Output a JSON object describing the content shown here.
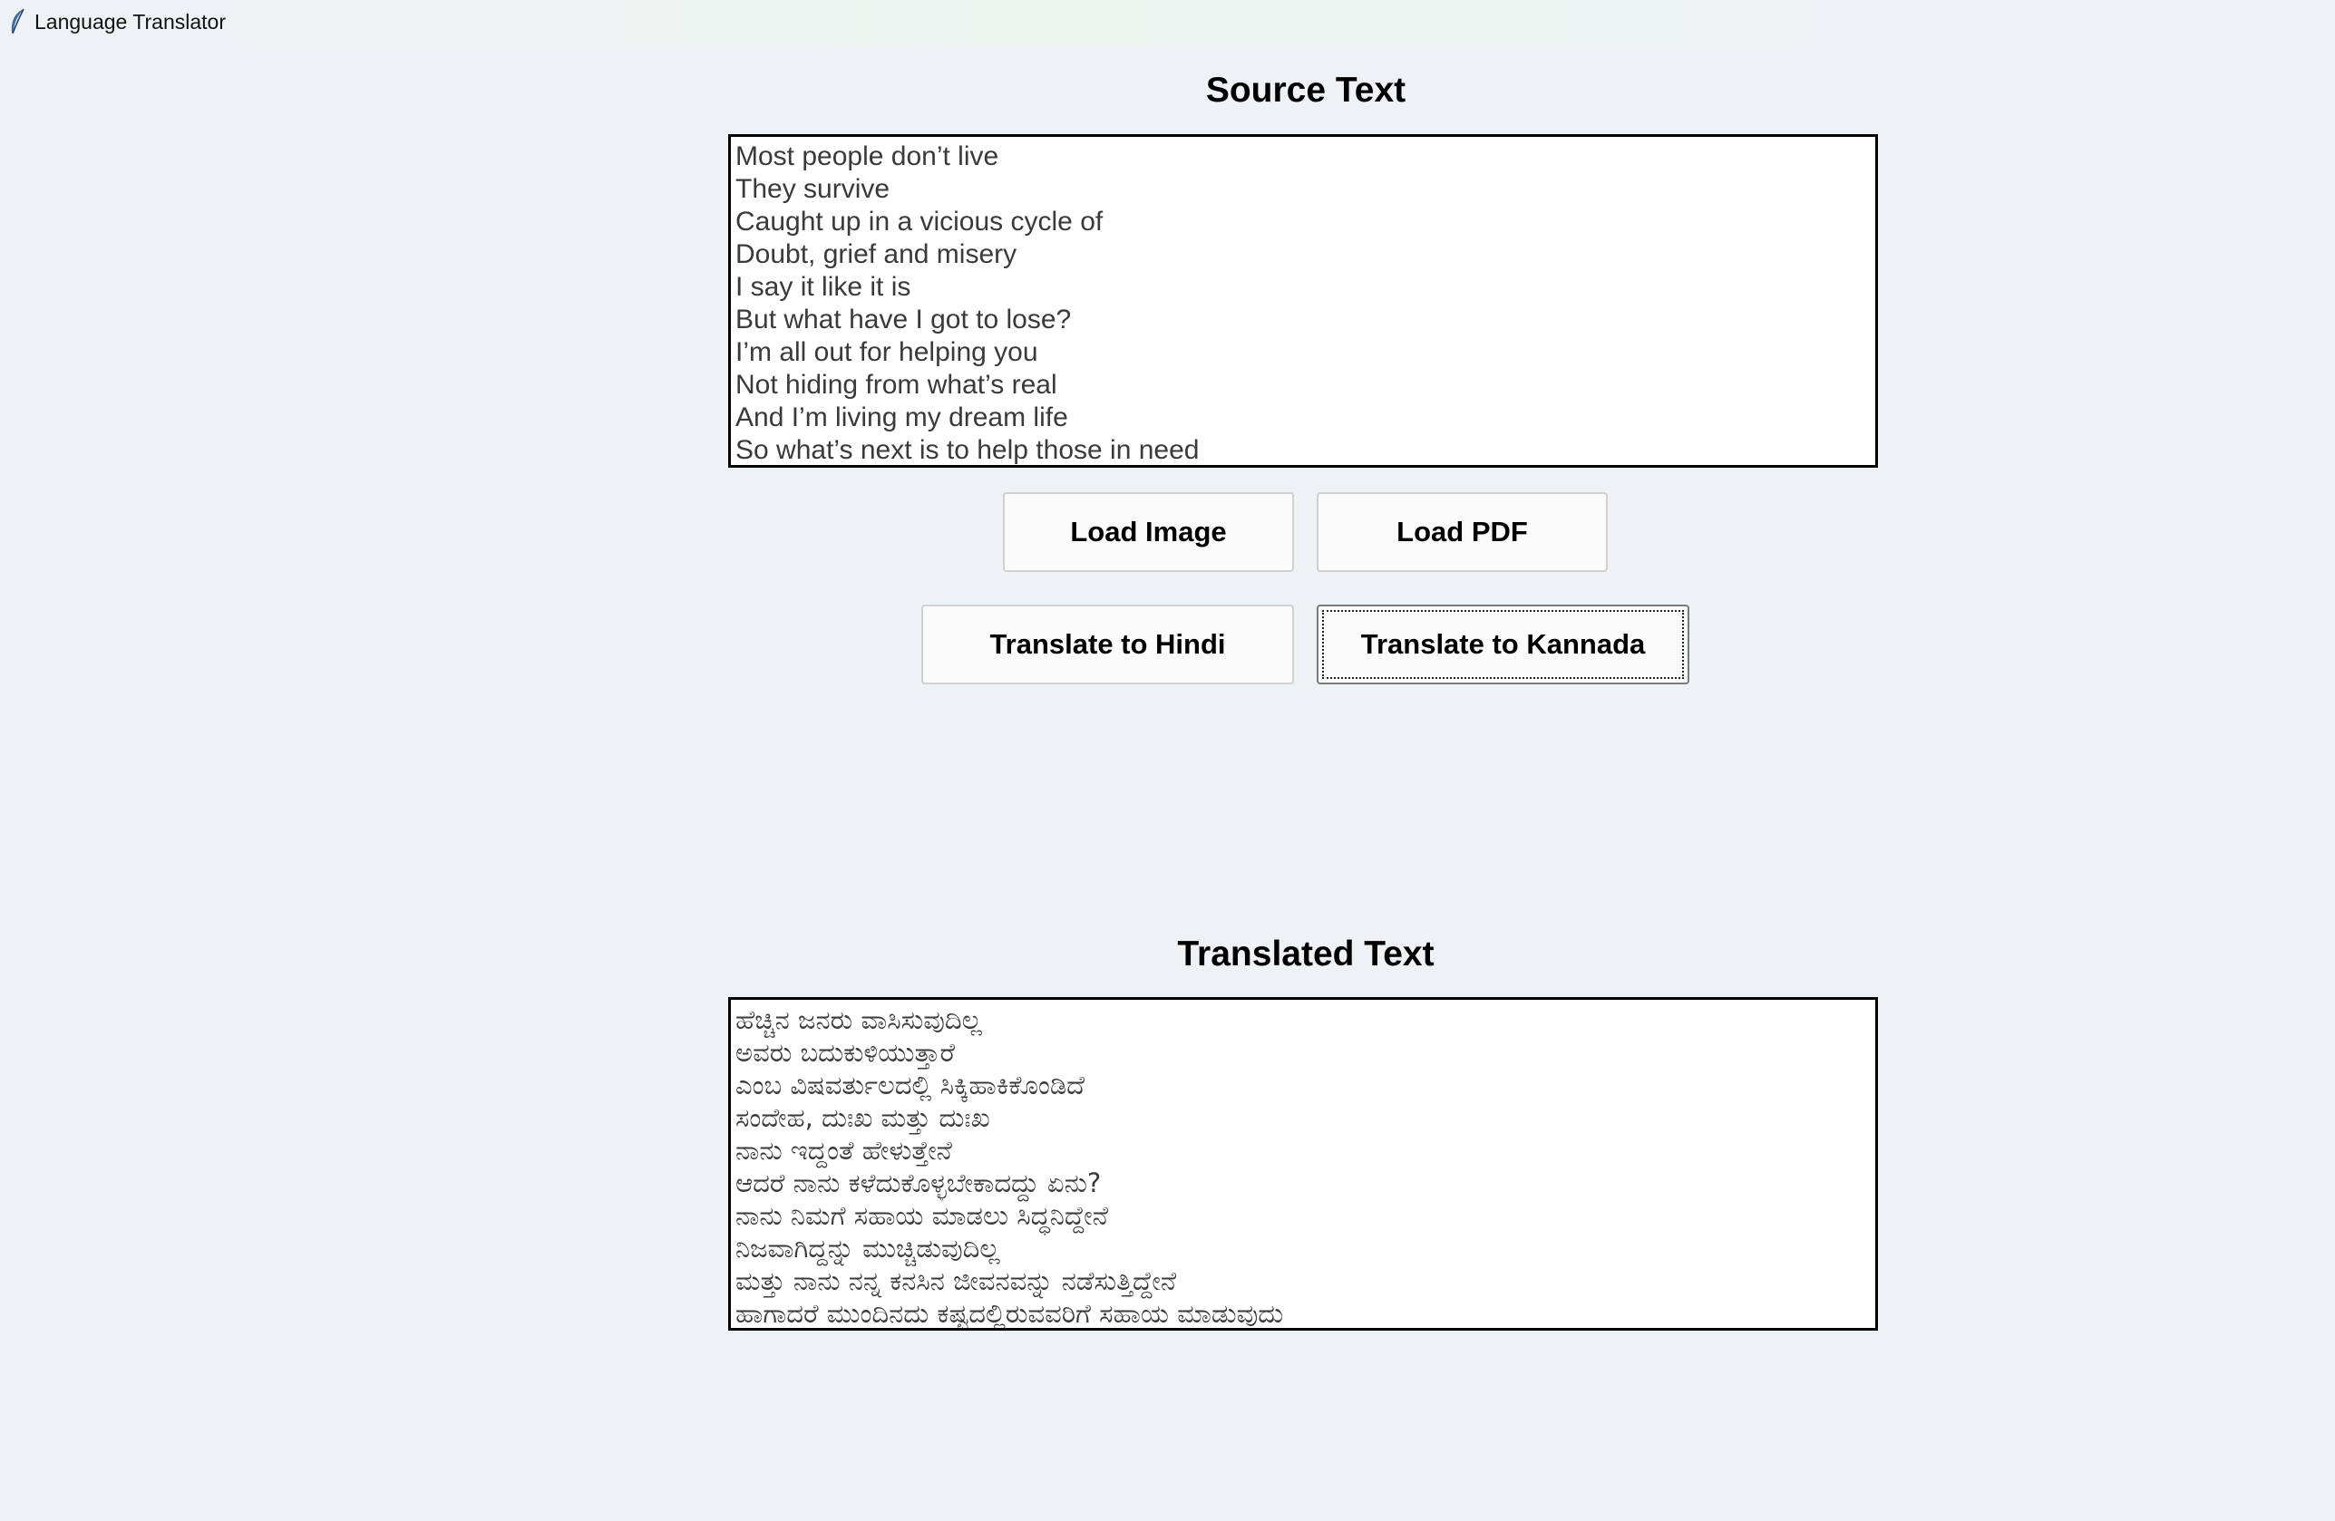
{
  "window": {
    "title": "Language Translator",
    "icon": "feather-icon"
  },
  "source": {
    "heading": "Source Text",
    "lines": [
      "Most people don’t live",
      "They survive",
      "Caught up in a vicious cycle of",
      "Doubt, grief and misery",
      "I say it like it is",
      "But what have I got to lose?",
      "I’m all out for helping you",
      "Not hiding from what’s real",
      "And I’m living my dream life",
      "So what’s next is to help those in need"
    ]
  },
  "buttons": {
    "load_image": "Load Image",
    "load_pdf": "Load PDF",
    "translate_hindi": "Translate to Hindi",
    "translate_kannada": "Translate to Kannada"
  },
  "translated": {
    "heading": "Translated Text",
    "lines": [
      "ಹೆಚ್ಚಿನ ಜನರು ವಾಸಿಸುವುದಿಲ್ಲ",
      "ಅವರು ಬದುಕುಳಿಯುತ್ತಾರೆ",
      "ಎಂಬ ವಿಷವರ್ತುಲದಲ್ಲಿ ಸಿಕ್ಕಿಹಾಕಿಕೊಂಡಿದೆ",
      "ಸಂದೇಹ, ದುಃಖ ಮತ್ತು ದುಃಖ",
      "ನಾನು ಇದ್ದಂತೆ ಹೇಳುತ್ತೇನೆ",
      "ಆದರೆ ನಾನು ಕಳೆದುಕೊಳ್ಳಬೇಕಾದದ್ದು ಏನು?",
      "ನಾನು ನಿಮಗೆ ಸಹಾಯ ಮಾಡಲು ಸಿದ್ಧನಿದ್ದೇನೆ",
      "ನಿಜವಾಗಿದ್ದನ್ನು ಮುಚ್ಚಿಡುವುದಿಲ್ಲ",
      "ಮತ್ತು ನಾನು ನನ್ನ ಕನಸಿನ ಜೀವನವನ್ನು ನಡೆಸುತ್ತಿದ್ದೇನೆ",
      "ಹಾಗಾದರೆ ಮುಂದಿನದು ಕಷ್ಟದಲ್ಲಿರುವವರಿಗೆ ಸಹಾಯ ಮಾಡುವುದು"
    ]
  },
  "colors": {
    "background": "#eef2f5",
    "textbox_border": "#000000",
    "button_face": "#fbfbfb"
  }
}
